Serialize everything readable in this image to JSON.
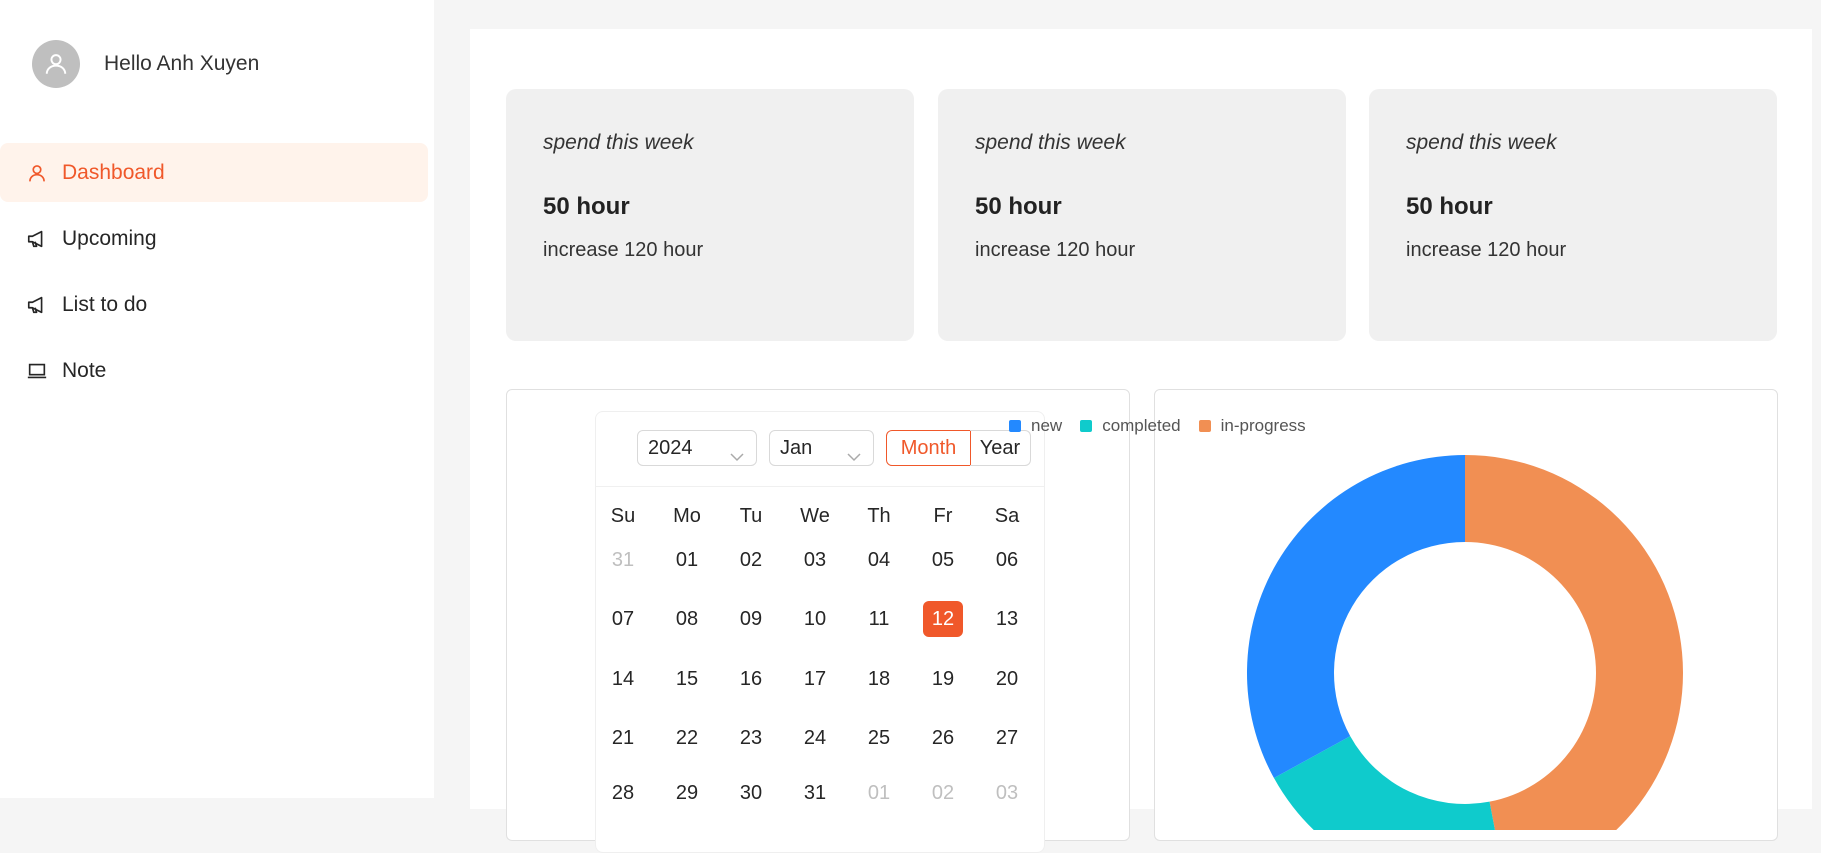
{
  "user": {
    "greeting": "Hello Anh Xuyen"
  },
  "menu": [
    {
      "label": "Dashboard",
      "icon": "user-icon",
      "active": true
    },
    {
      "label": "Upcoming",
      "icon": "megaphone-icon",
      "active": false
    },
    {
      "label": "List to do",
      "icon": "megaphone-icon",
      "active": false
    },
    {
      "label": "Note",
      "icon": "laptop-icon",
      "active": false
    }
  ],
  "stats": [
    {
      "title": "spend this week",
      "value": "50 hour",
      "change": "increase 120 hour"
    },
    {
      "title": "spend this week",
      "value": "50 hour",
      "change": "increase 120 hour"
    },
    {
      "title": "spend this week",
      "value": "50 hour",
      "change": "increase 120 hour"
    }
  ],
  "calendar": {
    "year": "2024",
    "month": "Jan",
    "modes": {
      "month": "Month",
      "year": "Year"
    },
    "weekdays": [
      "Su",
      "Mo",
      "Tu",
      "We",
      "Th",
      "Fr",
      "Sa"
    ],
    "days": [
      [
        "31",
        "01",
        "02",
        "03",
        "04",
        "05",
        "06"
      ],
      [
        "07",
        "08",
        "09",
        "10",
        "11",
        "12",
        "13"
      ],
      [
        "14",
        "15",
        "16",
        "17",
        "18",
        "19",
        "20"
      ],
      [
        "21",
        "22",
        "23",
        "24",
        "25",
        "26",
        "27"
      ],
      [
        "28",
        "29",
        "30",
        "31",
        "01",
        "02",
        "03"
      ]
    ],
    "muted": [
      [
        0,
        0
      ],
      [
        4,
        4
      ],
      [
        4,
        5
      ],
      [
        4,
        6
      ]
    ],
    "selected": [
      1,
      5
    ]
  },
  "chart_data": {
    "type": "pie",
    "style": "donut",
    "legend_position": "top",
    "series": [
      {
        "name": "new",
        "value": 33,
        "color": "#2389ff"
      },
      {
        "name": "completed",
        "value": 20,
        "color": "#0fcbcc"
      },
      {
        "name": "in-progress",
        "value": 47,
        "color": "#f18f53"
      }
    ]
  },
  "colors": {
    "accent": "#f0582a",
    "active_bg": "#fff3eb"
  }
}
